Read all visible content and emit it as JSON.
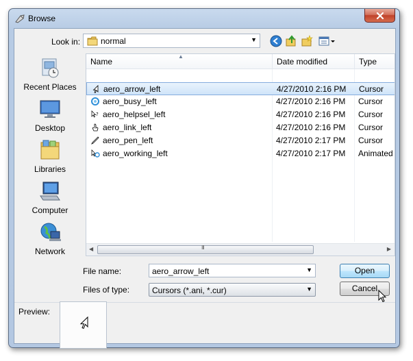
{
  "window": {
    "title": "Browse",
    "close_icon": "close-icon"
  },
  "lookin": {
    "label": "Look in:",
    "value": "normal",
    "folder_icon": "folder-icon"
  },
  "toolbar": {
    "icons": [
      "back-icon",
      "up-folder-icon",
      "new-folder-icon",
      "view-menu-icon"
    ]
  },
  "places": [
    {
      "label": "Recent Places",
      "icon": "recent-places-icon"
    },
    {
      "label": "Desktop",
      "icon": "desktop-icon"
    },
    {
      "label": "Libraries",
      "icon": "libraries-icon"
    },
    {
      "label": "Computer",
      "icon": "computer-icon"
    },
    {
      "label": "Network",
      "icon": "network-icon"
    }
  ],
  "columns": {
    "name": "Name",
    "date": "Date modified",
    "type": "Type"
  },
  "files": [
    {
      "name": "aero_arrow_left",
      "date": "4/27/2010 2:16 PM",
      "type": "Cursor",
      "icon": "arrow-cursor-icon",
      "selected": true
    },
    {
      "name": "aero_busy_left",
      "date": "4/27/2010 2:16 PM",
      "type": "Cursor",
      "icon": "busy-cursor-icon",
      "selected": false
    },
    {
      "name": "aero_helpsel_left",
      "date": "4/27/2010 2:16 PM",
      "type": "Cursor",
      "icon": "help-cursor-icon",
      "selected": false
    },
    {
      "name": "aero_link_left",
      "date": "4/27/2010 2:16 PM",
      "type": "Cursor",
      "icon": "link-cursor-icon",
      "selected": false
    },
    {
      "name": "aero_pen_left",
      "date": "4/27/2010 2:17 PM",
      "type": "Cursor",
      "icon": "pen-cursor-icon",
      "selected": false
    },
    {
      "name": "aero_working_left",
      "date": "4/27/2010 2:17 PM",
      "type": "Animated",
      "icon": "working-cursor-icon",
      "selected": false
    }
  ],
  "filename": {
    "label": "File name:",
    "value": "aero_arrow_left"
  },
  "filetype": {
    "label": "Files of type:",
    "value": "Cursors (*.ani, *.cur)"
  },
  "buttons": {
    "open": "Open",
    "cancel": "Cancel"
  },
  "scrollbar": {
    "grip": "III"
  },
  "preview": {
    "label": "Preview:"
  },
  "colors": {
    "selection": "#cfe4f9",
    "accent": "#3c7fb1"
  }
}
